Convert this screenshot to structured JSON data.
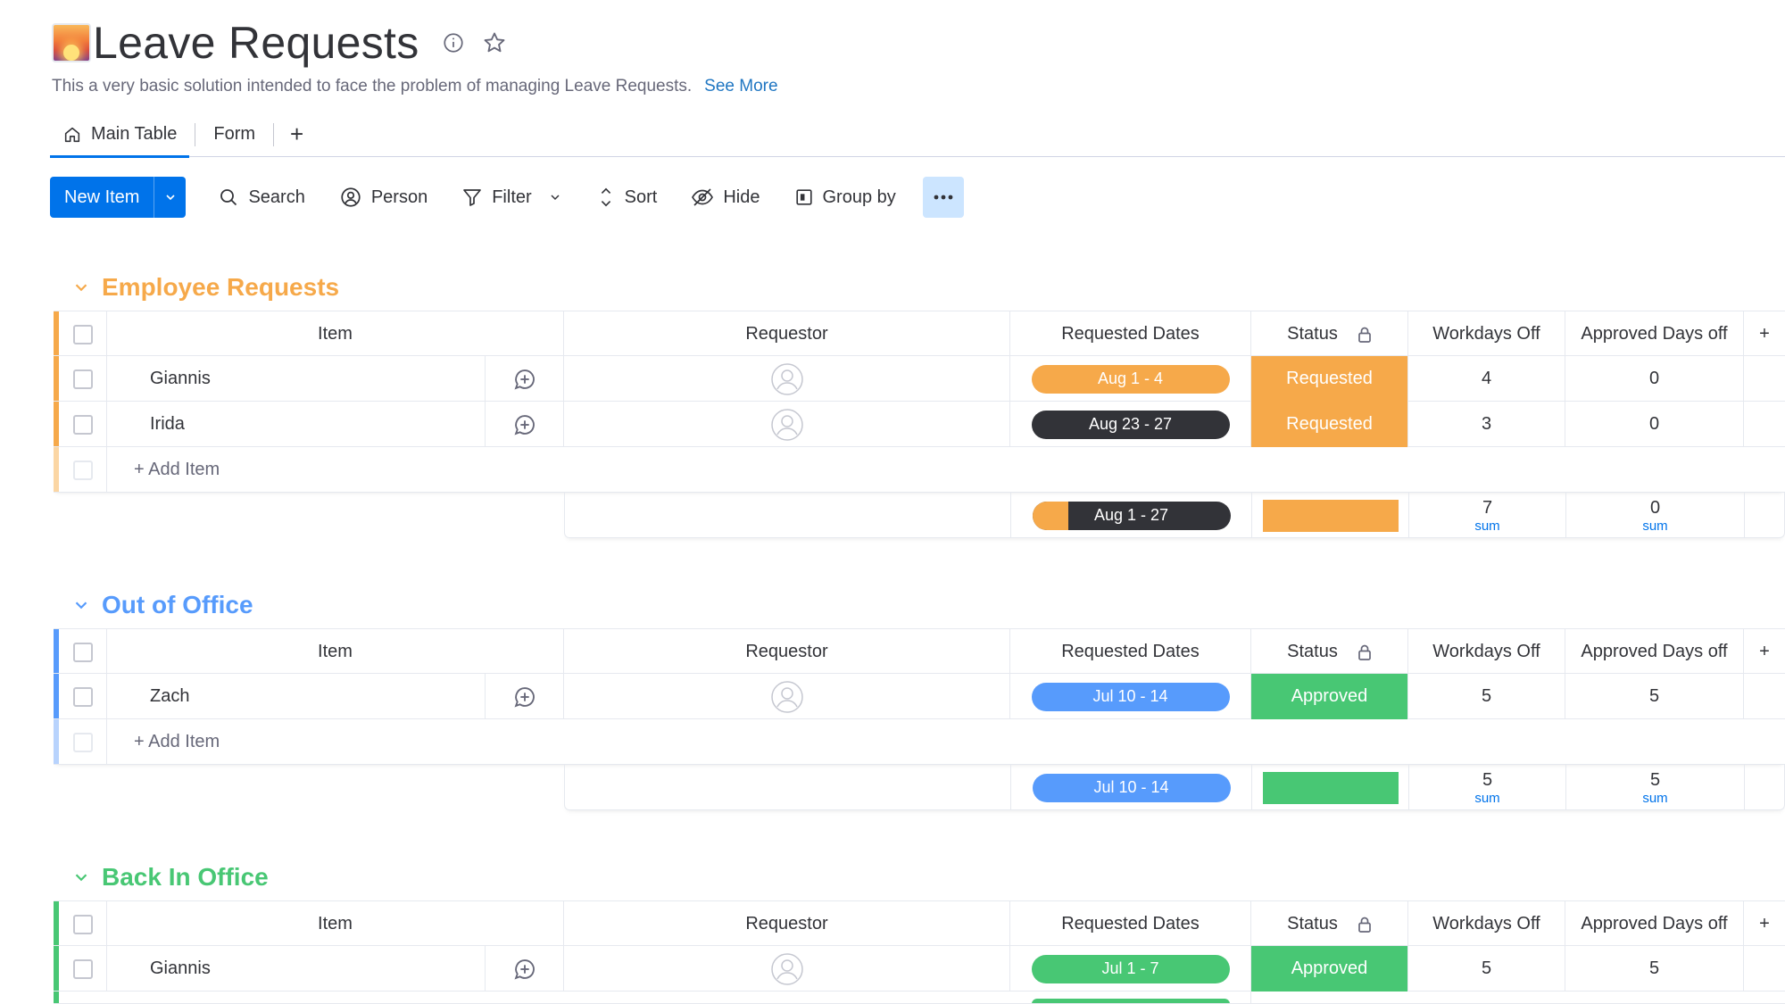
{
  "board": {
    "title": "Leave Requests",
    "description": "This a very basic solution intended to face the problem of managing Leave Requests.",
    "see_more": "See More"
  },
  "tabs": [
    {
      "label": "Main Table",
      "icon": "home-icon",
      "active": true
    },
    {
      "label": "Form",
      "active": false
    },
    {
      "label": "+"
    }
  ],
  "toolbar": {
    "new_item": "New Item",
    "search": "Search",
    "person": "Person",
    "filter": "Filter",
    "sort": "Sort",
    "hide": "Hide",
    "group_by": "Group by"
  },
  "columns": {
    "item": "Item",
    "requestor": "Requestor",
    "requested_dates": "Requested Dates",
    "status": "Status",
    "workdays_off": "Workdays Off",
    "approved_days_off": "Approved Days off"
  },
  "add_item": "+ Add Item",
  "sum_label": "sum",
  "colors": {
    "orange": "#f6a94a",
    "blue": "#579bfc",
    "green": "#48c774",
    "dark": "#323338",
    "accent": "#0073ea"
  },
  "groups": [
    {
      "name": "Employee Requests",
      "color": "#f6a94a",
      "rows": [
        {
          "item": "Giannis",
          "dates": "Aug 1 - 4",
          "date_color": "#f6a94a",
          "status": "Requested",
          "status_color": "#f6a94a",
          "workdays_off": "4",
          "approved": "0"
        },
        {
          "item": "Irida",
          "dates": "Aug 23 - 27",
          "date_color": "#323338",
          "status": "Requested",
          "status_color": "#f6a94a",
          "workdays_off": "3",
          "approved": "0"
        }
      ],
      "summary": {
        "dates": "Aug 1 - 27",
        "date_progress": 0.18,
        "date_progress_color": "#f6a94a",
        "status_color": "#f6a94a",
        "workdays_off": "7",
        "approved": "0"
      }
    },
    {
      "name": "Out of Office",
      "color": "#579bfc",
      "rows": [
        {
          "item": "Zach",
          "dates": "Jul 10 - 14",
          "date_color": "#579bfc",
          "status": "Approved",
          "status_color": "#48c774",
          "workdays_off": "5",
          "approved": "5"
        }
      ],
      "summary": {
        "dates": "Jul 10 - 14",
        "date_progress": 1.0,
        "date_progress_color": "#579bfc",
        "status_color": "#48c774",
        "workdays_off": "5",
        "approved": "5"
      }
    },
    {
      "name": "Back In Office",
      "color": "#48c774",
      "rows": [
        {
          "item": "Giannis",
          "dates": "Jul 1 - 7",
          "date_color": "#48c774",
          "status": "Approved",
          "status_color": "#48c774",
          "workdays_off": "5",
          "approved": "5"
        }
      ]
    }
  ]
}
